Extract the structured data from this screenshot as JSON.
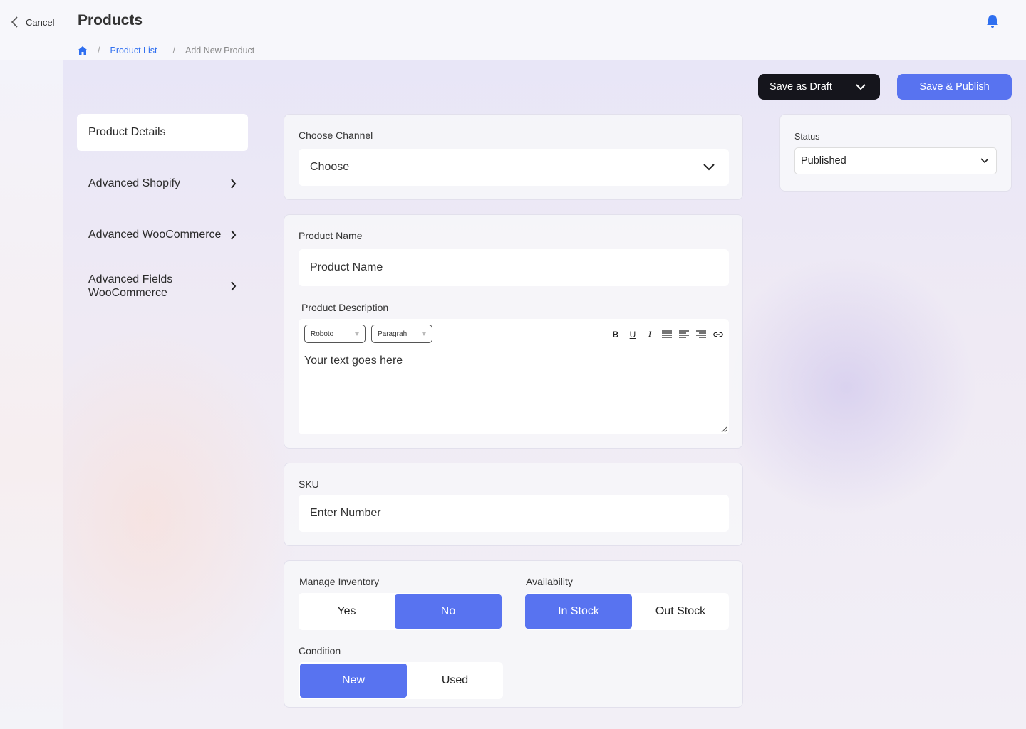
{
  "header": {
    "cancel_label": "Cancel",
    "title": "Products"
  },
  "breadcrumb": {
    "items": [
      "Product List",
      "Add New Product"
    ],
    "separator": "/"
  },
  "actions": {
    "draft_label": "Save as Draft",
    "publish_label": "Save & Publish"
  },
  "sidebar": {
    "items": [
      {
        "label": "Product Details",
        "active": true
      },
      {
        "label": "Advanced Shopify"
      },
      {
        "label": "Advanced WooCommerce"
      },
      {
        "label": "Advanced Fields WooCommerce"
      }
    ]
  },
  "channel": {
    "label": "Choose Channel",
    "value": "Choose"
  },
  "product": {
    "name_label": "Product Name",
    "name_placeholder": "Product Name",
    "description_label": "Product Description",
    "font_value": "Roboto",
    "block_value": "Paragrah",
    "description_placeholder": "Your text goes here",
    "toolbar": {
      "bold": "B",
      "underline": "U",
      "italic": "I"
    }
  },
  "sku": {
    "label": "SKU",
    "placeholder": "Enter Number"
  },
  "inventory": {
    "label": "Manage Inventory",
    "options": [
      "Yes",
      "No"
    ],
    "selected": "No"
  },
  "availability": {
    "label": "Availability",
    "options": [
      "In Stock",
      "Out Stock"
    ],
    "selected": "In Stock"
  },
  "condition": {
    "label": "Condition",
    "options": [
      "New",
      "Used"
    ],
    "selected": "New"
  },
  "status": {
    "label": "Status",
    "value": "Published"
  },
  "colors": {
    "accent": "#5873f0",
    "dark": "#15151c",
    "link": "#2f6ff0"
  }
}
